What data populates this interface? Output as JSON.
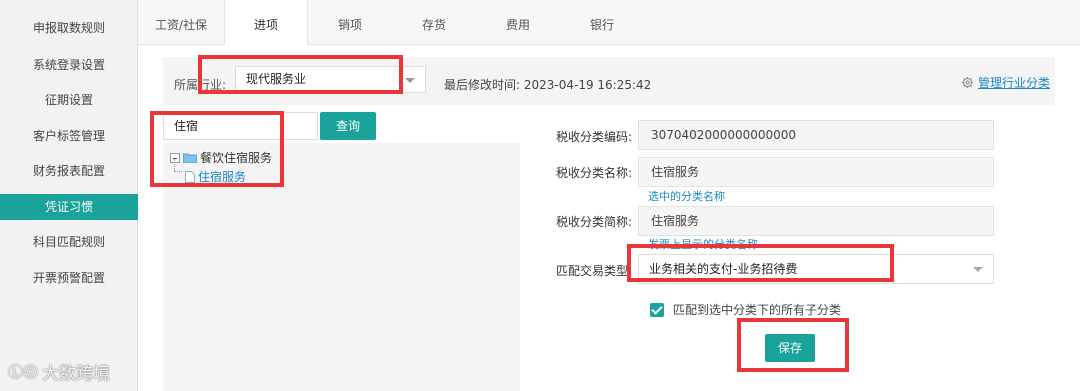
{
  "sidebar": {
    "items": [
      {
        "label": "申报取数规则"
      },
      {
        "label": "系统登录设置"
      },
      {
        "label": "征期设置"
      },
      {
        "label": "客户标签管理"
      },
      {
        "label": "财务报表配置"
      },
      {
        "label": "凭证习惯"
      },
      {
        "label": "科目匹配规则"
      },
      {
        "label": "开票预警配置"
      }
    ],
    "active_index": 5
  },
  "watermark": {
    "logo": "ⓁⓄ",
    "text": "大数跨境"
  },
  "tabs": [
    {
      "label": "工资/社保"
    },
    {
      "label": "进项"
    },
    {
      "label": "销项"
    },
    {
      "label": "存货"
    },
    {
      "label": "费用"
    },
    {
      "label": "银行"
    }
  ],
  "active_tab": "进项",
  "industry": {
    "label": "所属行业:",
    "value": "现代服务业",
    "modified_text": "最后修改时间: 2023-04-19 16:25:42",
    "manage_label": "管理行业分类"
  },
  "search": {
    "value": "住宿",
    "button_label": "查询"
  },
  "tree": {
    "parent_label": "餐饮住宿服务",
    "child_label": "住宿服务"
  },
  "form": {
    "tax_code_label": "税收分类编码:",
    "tax_code_value": "3070402000000000000",
    "tax_name_label": "税收分类名称:",
    "tax_name_value": "住宿服务",
    "tax_name_hint": "选中的分类名称",
    "tax_short_label": "税收分类简称:",
    "tax_short_value": "住宿服务",
    "tax_short_hint": "发票上显示的分类名称",
    "match_type_label": "匹配交易类型",
    "match_type_value": "业务相关的支付-业务招待费",
    "match_children_label": "匹配到选中分类下的所有子分类",
    "match_children_checked": true,
    "save_label": "保存"
  },
  "colors": {
    "accent": "#1aa39a",
    "link": "#1a88c9",
    "annotation": "#e8363a"
  }
}
